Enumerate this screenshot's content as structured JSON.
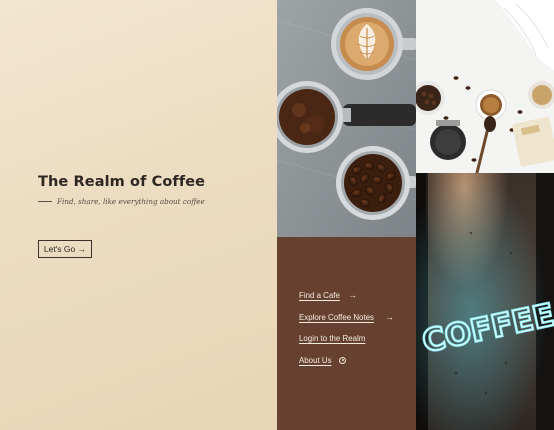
{
  "hero": {
    "title": "The Realm of Coffee",
    "tagline": "Find, share, like everything about coffee",
    "cta_label": "Let's Go →"
  },
  "images": {
    "portafilters": "portafilters-photo",
    "flat_lay": "coffee-flat-lay-photo",
    "neon_sign": "neon-coffee-sign-photo",
    "neon_text": "COFFEE"
  },
  "nav": {
    "items": [
      {
        "label": "Find a Cafe",
        "icon": "arrow-right-icon"
      },
      {
        "label": "Explore Coffee Notes",
        "icon": "arrow-right-icon"
      },
      {
        "label": "Login to the Realm",
        "icon": ""
      },
      {
        "label": "About Us",
        "icon": "target-icon"
      }
    ]
  },
  "colors": {
    "hero_bg": "#efe1c9",
    "nav_bg": "#67412f",
    "nav_text": "#f5ebe0",
    "neon": "#7fe7f2"
  }
}
